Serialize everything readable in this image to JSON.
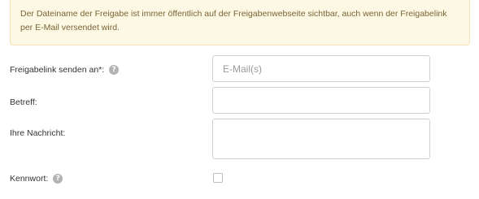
{
  "notice": {
    "text": "Der Dateiname der Freigabe ist immer öffentlich auf der Freigabenwebseite sichtbar, auch wenn der Freigabelink per E-Mail versendet wird."
  },
  "form": {
    "recipients": {
      "label": "Freigabelink senden an*:",
      "placeholder": "E-Mail(s)",
      "value": "",
      "help_icon": "?"
    },
    "subject": {
      "label": "Betreff:",
      "value": ""
    },
    "message": {
      "label": "Ihre Nachricht:",
      "value": ""
    },
    "password": {
      "label": "Kennwort:",
      "checked": false,
      "help_icon": "?"
    }
  }
}
